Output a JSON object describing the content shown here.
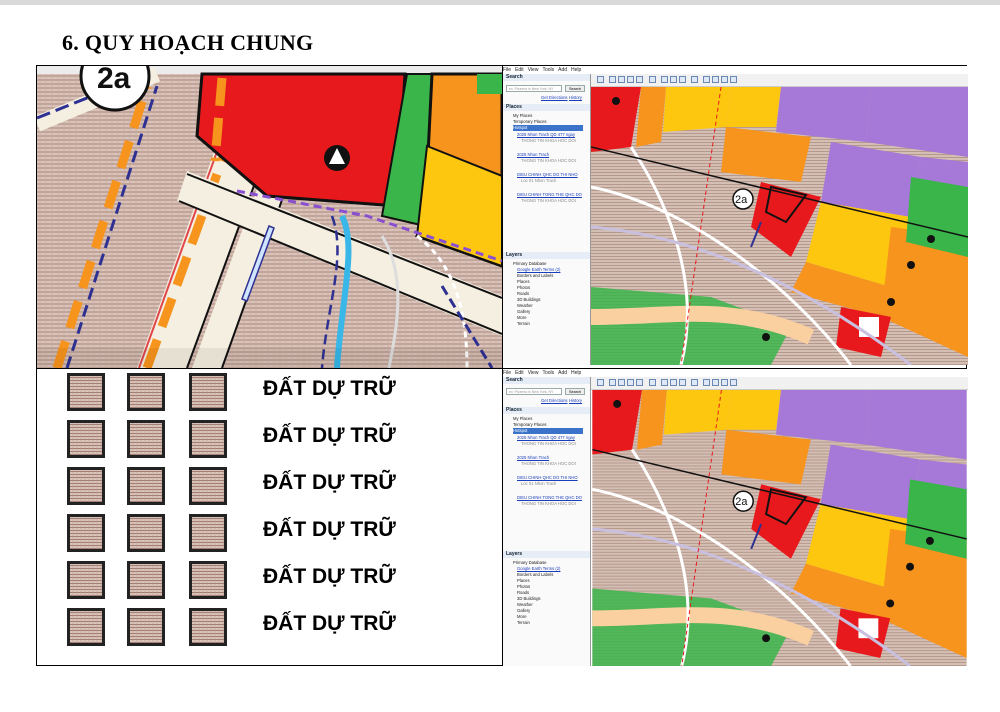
{
  "page": {
    "heading": "6. QUY HOẠCH CHUNG"
  },
  "top_left": {
    "zone_label": "2a"
  },
  "legend": {
    "items": [
      {
        "label": "ĐẤT DỰ TRỮ"
      },
      {
        "label": "ĐẤT DỰ TRỮ"
      },
      {
        "label": "ĐẤT DỰ TRỮ"
      },
      {
        "label": "ĐẤT DỰ TRỮ"
      },
      {
        "label": "ĐẤT DỰ TRỮ"
      },
      {
        "label": "ĐẤT DỰ TRỮ"
      }
    ]
  },
  "google_earth": {
    "menu": [
      "File",
      "Edit",
      "View",
      "Tools",
      "Add",
      "Help"
    ],
    "search_header": "Search",
    "search_placeholder": "ex: Pizzeria in New York, NY",
    "search_button": "Search",
    "links": [
      "Get Directions",
      "History"
    ],
    "places_header": "Places",
    "places": [
      {
        "label": "My Places",
        "style": "normal"
      },
      {
        "label": "Temporary Places",
        "style": "normal"
      },
      {
        "label": "Hotspot",
        "style": "sel"
      },
      {
        "label": "2025 Nhon Trach QD 477 ngay",
        "style": "link"
      },
      {
        "label": "THONG TIN KHOA HOC DOI",
        "style": "dim"
      },
      {
        "label": "2025 Nhon Trach",
        "style": "link"
      },
      {
        "label": "THONG TIN KHOA HOC DOI",
        "style": "dim"
      },
      {
        "label": "DIEU CHINH QHC DO THI NHO",
        "style": "link"
      },
      {
        "label": "Loc 01 Nhon Trach",
        "style": "dim"
      },
      {
        "label": "DIEU CHINH TONG THE QHC DO",
        "style": "link"
      },
      {
        "label": "THONG TIN KHOA HOC DOI",
        "style": "dim"
      }
    ],
    "layers_header": "Layers",
    "layers": [
      "Primary Database",
      "Google Earth Terms (2)",
      "Borders and Labels",
      "Places",
      "Photos",
      "Roads",
      "3D Buildings",
      "Weather",
      "Gallery",
      "More",
      "Terrain"
    ],
    "zone_label": "2a"
  },
  "colors": {
    "reserve_land": "#d8c4bb",
    "red_zone": "#e8191c",
    "orange_zone": "#f7941d",
    "yellow_zone": "#fdc70f",
    "green_zone": "#39b54a",
    "purple_zone": "#a678d8",
    "road_blue": "#2e3192"
  }
}
